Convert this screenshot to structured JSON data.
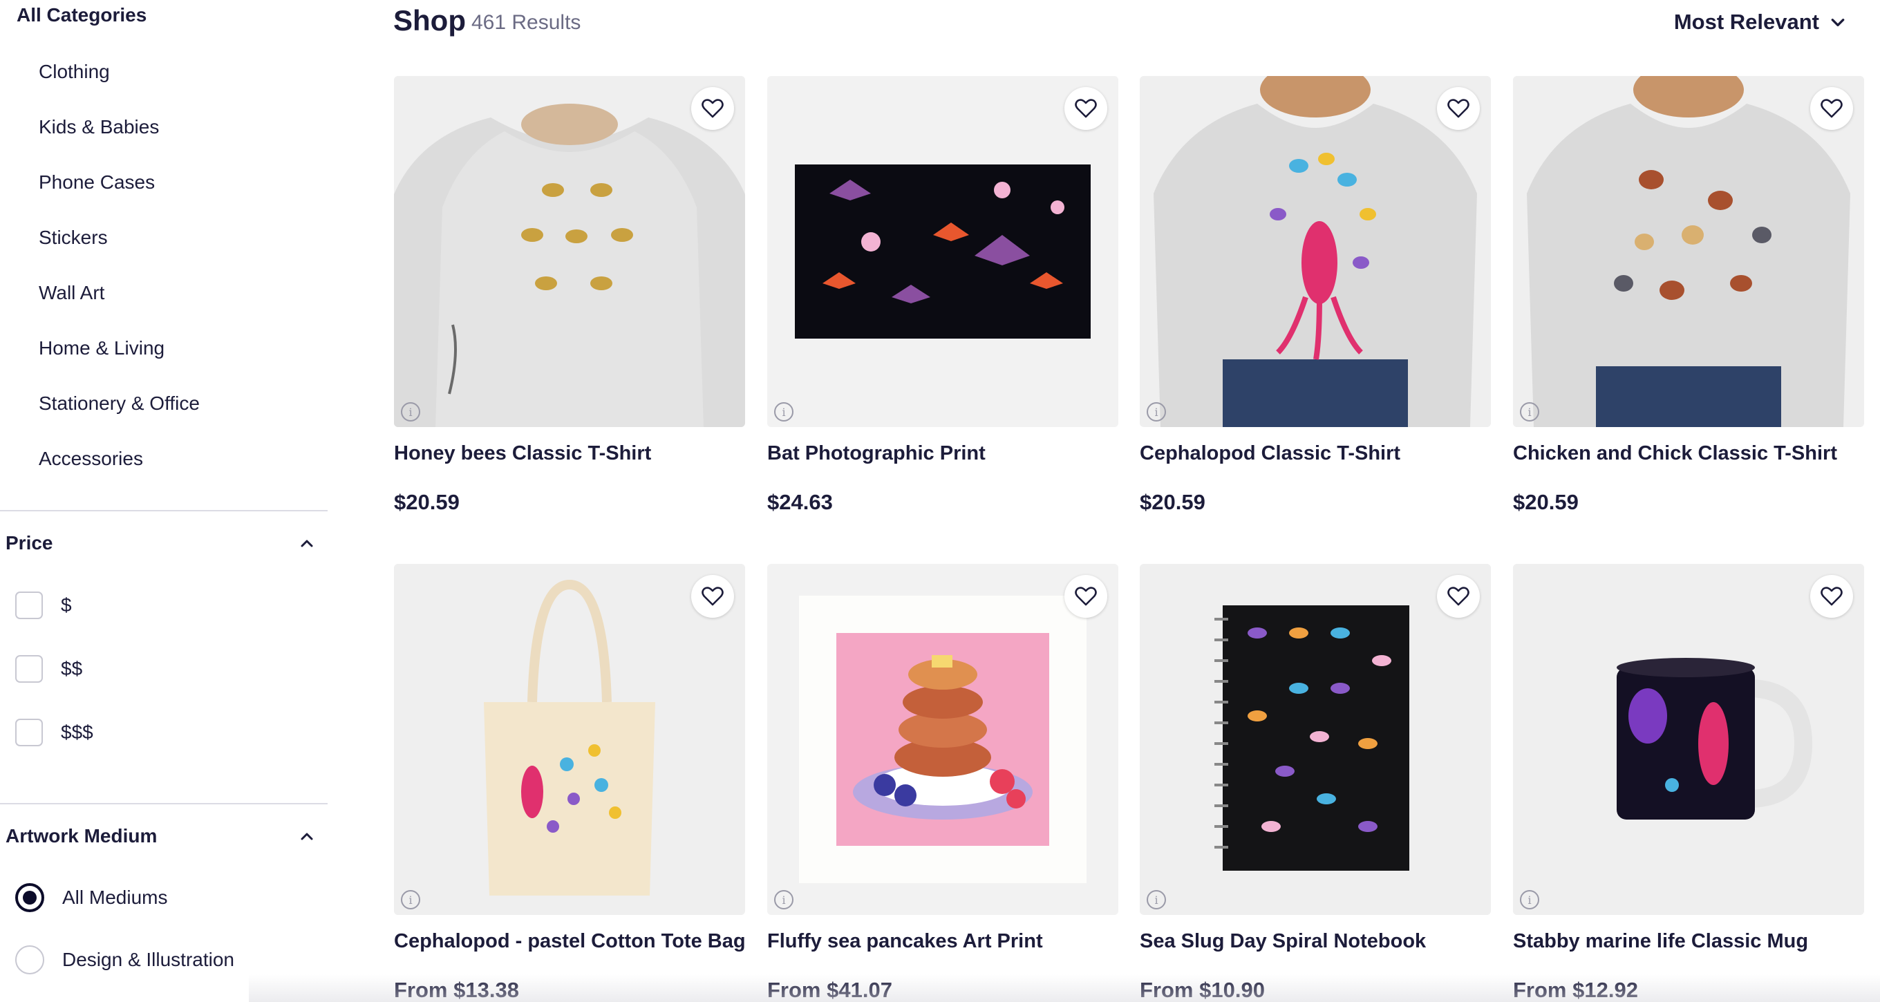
{
  "sidebar": {
    "all_categories": "All Categories",
    "categories": [
      {
        "label": "Clothing"
      },
      {
        "label": "Kids & Babies"
      },
      {
        "label": "Phone Cases"
      },
      {
        "label": "Stickers"
      },
      {
        "label": "Wall Art"
      },
      {
        "label": "Home & Living"
      },
      {
        "label": "Stationery & Office"
      },
      {
        "label": "Accessories"
      }
    ],
    "price": {
      "title": "Price",
      "options": [
        {
          "label": "$",
          "checked": false
        },
        {
          "label": "$$",
          "checked": false
        },
        {
          "label": "$$$",
          "checked": false
        }
      ]
    },
    "medium": {
      "title": "Artwork Medium",
      "options": [
        {
          "label": "All Mediums",
          "selected": true
        },
        {
          "label": "Design & Illustration",
          "selected": false
        }
      ]
    }
  },
  "header": {
    "title": "Shop",
    "results": "461 Results",
    "sort": "Most Relevant"
  },
  "products": [
    {
      "title": "Honey bees Classic T-Shirt",
      "price": "$20.59",
      "icon": "tshirt-bees"
    },
    {
      "title": "Bat Photographic Print",
      "price": "$24.63",
      "icon": "print-bats"
    },
    {
      "title": "Cephalopod Classic T-Shirt",
      "price": "$20.59",
      "icon": "tshirt-cephalopod"
    },
    {
      "title": "Chicken and Chick Classic T-Shirt",
      "price": "$20.59",
      "icon": "tshirt-chicken"
    },
    {
      "title": "Cephalopod - pastel Cotton Tote Bag",
      "price": "From $13.38",
      "icon": "tote-bag"
    },
    {
      "title": "Fluffy sea pancakes Art Print",
      "price": "From $41.07",
      "icon": "art-print-pancakes"
    },
    {
      "title": "Sea Slug Day Spiral Notebook",
      "price": "From $10.90",
      "icon": "spiral-notebook"
    },
    {
      "title": "Stabby marine life Classic Mug",
      "price": "From $12.92",
      "icon": "mug"
    }
  ],
  "colors": {
    "text": "#1c1c3a",
    "muted": "#6b6b84",
    "image_bg": "#f2f2f2",
    "divider": "#dcdce4"
  }
}
